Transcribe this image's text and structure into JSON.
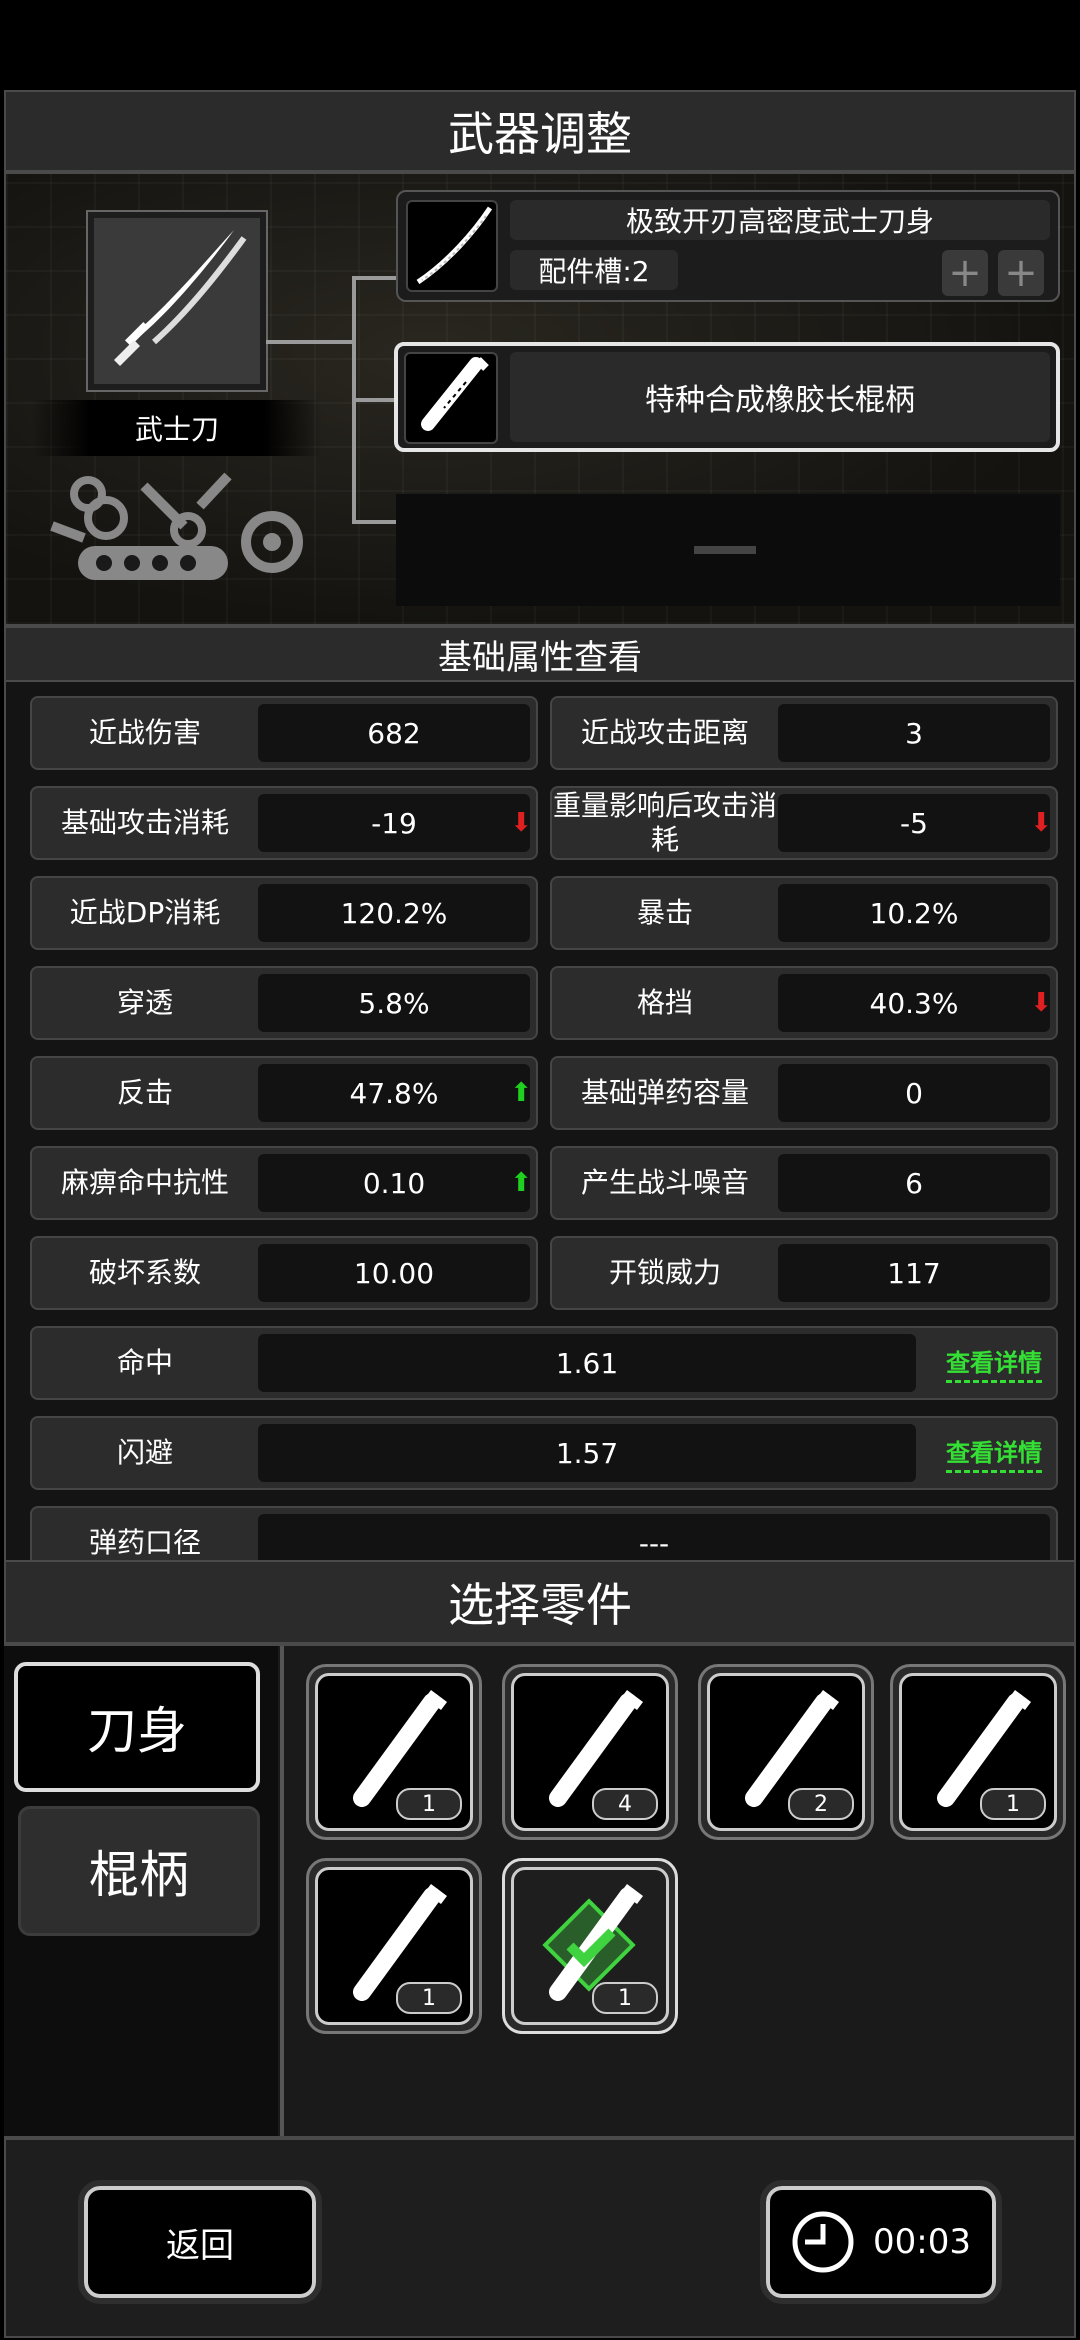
{
  "header": {
    "title": "武器调整"
  },
  "weapon": {
    "name": "武士刀"
  },
  "slots": [
    {
      "name": "极致开刃高密度武士刀身",
      "sub": "配件槽:2"
    },
    {
      "name": "特种合成橡胶长棍柄"
    }
  ],
  "stats_section": {
    "title": "基础属性查看"
  },
  "stats": [
    {
      "label": "近战伤害",
      "value": "682"
    },
    {
      "label": "近战攻击距离",
      "value": "3"
    },
    {
      "label": "基础攻击消耗",
      "value": "-19",
      "trend": "down"
    },
    {
      "label": "重量影响后攻击消耗",
      "value": "-5",
      "trend": "down"
    },
    {
      "label": "近战DP消耗",
      "value": "120.2%"
    },
    {
      "label": "暴击",
      "value": "10.2%"
    },
    {
      "label": "穿透",
      "value": "5.8%"
    },
    {
      "label": "格挡",
      "value": "40.3%",
      "trend": "down"
    },
    {
      "label": "反击",
      "value": "47.8%",
      "trend": "up"
    },
    {
      "label": "基础弹药容量",
      "value": "0"
    },
    {
      "label": "麻痹命中抗性",
      "value": "0.10",
      "trend": "up"
    },
    {
      "label": "产生战斗噪音",
      "value": "6"
    },
    {
      "label": "破坏系数",
      "value": "10.00"
    },
    {
      "label": "开锁威力",
      "value": "117"
    }
  ],
  "wide_stats": [
    {
      "label": "命中",
      "value": "1.61",
      "link": "查看详情"
    },
    {
      "label": "闪避",
      "value": "1.57",
      "link": "查看详情"
    },
    {
      "label": "弹药口径",
      "value": "---"
    }
  ],
  "parts_section": {
    "title": "选择零件"
  },
  "categories": [
    {
      "label": "刀身"
    },
    {
      "label": "棍柄"
    }
  ],
  "parts": [
    {
      "count": "1"
    },
    {
      "count": "4"
    },
    {
      "count": "2"
    },
    {
      "count": "1"
    },
    {
      "count": "1"
    },
    {
      "count": "1",
      "selected": true
    }
  ],
  "footer": {
    "back_label": "返回",
    "timer": "00:03"
  },
  "colors": {
    "up": "#20d020",
    "down": "#e02020",
    "link": "#35e035",
    "selected": "#3fd43f"
  }
}
